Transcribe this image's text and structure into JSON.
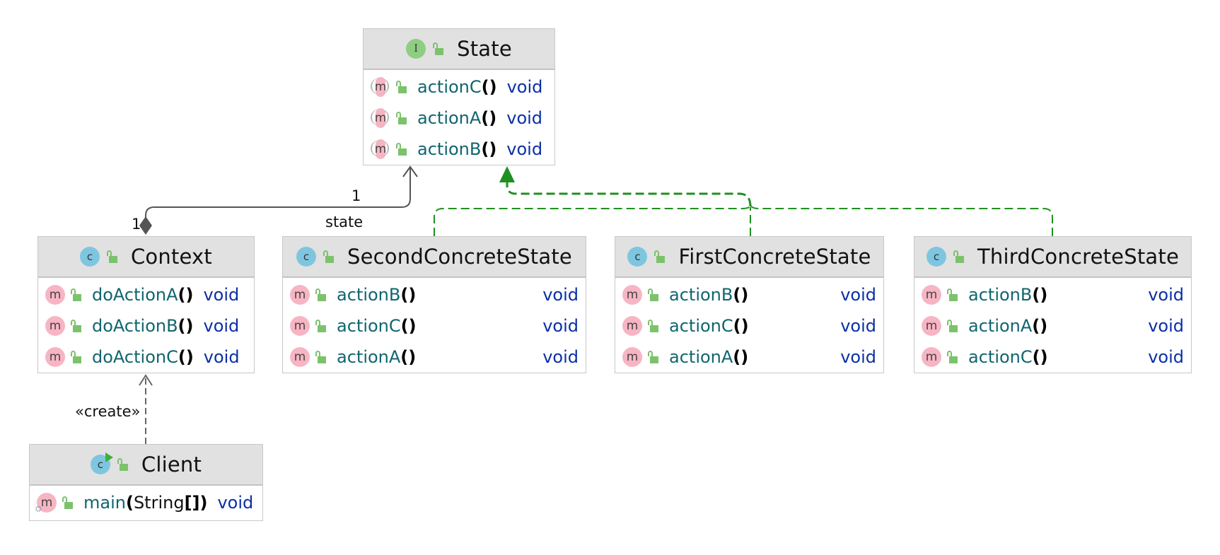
{
  "diagram": {
    "type": "UML class diagram",
    "pattern": "State"
  },
  "colors": {
    "header_bg": "#e1e1e1",
    "border": "#c8c8c8",
    "method_name": "#10656f",
    "return_type": "#0a2fa6",
    "class_icon": "#7ec6e0",
    "interface_icon": "#8fce82",
    "method_icon": "#f7b5c3",
    "lock_icon": "#7cc26c",
    "realization_edge": "#1f8f1f",
    "association_edge": "#555555"
  },
  "nodes": {
    "state": {
      "name": "State",
      "kind": "interface",
      "kind_glyph": "I",
      "methods": [
        {
          "name": "actionC",
          "parens": "()",
          "params": "",
          "parens_close": "",
          "return": "void",
          "abstract": true
        },
        {
          "name": "actionA",
          "parens": "()",
          "params": "",
          "parens_close": "",
          "return": "void",
          "abstract": true
        },
        {
          "name": "actionB",
          "parens": "()",
          "params": "",
          "parens_close": "",
          "return": "void",
          "abstract": true
        }
      ]
    },
    "context": {
      "name": "Context",
      "kind": "class",
      "kind_glyph": "c",
      "methods": [
        {
          "name": "doActionA",
          "parens": "()",
          "return": "void"
        },
        {
          "name": "doActionB",
          "parens": "()",
          "return": "void"
        },
        {
          "name": "doActionC",
          "parens": "()",
          "return": "void"
        }
      ]
    },
    "second": {
      "name": "SecondConcreteState",
      "kind": "class",
      "kind_glyph": "c",
      "methods": [
        {
          "name": "actionB",
          "parens": "()",
          "return": "void"
        },
        {
          "name": "actionC",
          "parens": "()",
          "return": "void"
        },
        {
          "name": "actionA",
          "parens": "()",
          "return": "void"
        }
      ]
    },
    "first": {
      "name": "FirstConcreteState",
      "kind": "class",
      "kind_glyph": "c",
      "methods": [
        {
          "name": "actionB",
          "parens": "()",
          "return": "void"
        },
        {
          "name": "actionC",
          "parens": "()",
          "return": "void"
        },
        {
          "name": "actionA",
          "parens": "()",
          "return": "void"
        }
      ]
    },
    "third": {
      "name": "ThirdConcreteState",
      "kind": "class",
      "kind_glyph": "c",
      "methods": [
        {
          "name": "actionB",
          "parens": "()",
          "return": "void"
        },
        {
          "name": "actionA",
          "parens": "()",
          "return": "void"
        },
        {
          "name": "actionC",
          "parens": "()",
          "return": "void"
        }
      ]
    },
    "client": {
      "name": "Client",
      "kind": "class-executable",
      "kind_glyph": "c",
      "methods": [
        {
          "name": "main",
          "open": "(",
          "params": "String",
          "brackets": "[]",
          "close": ")",
          "return": "void",
          "static": true,
          "static_glyph": "⛭"
        }
      ]
    }
  },
  "edges": {
    "association": {
      "from": "Context",
      "to": "State",
      "kind": "composition",
      "source_multiplicity": "1",
      "target_multiplicity": "1",
      "role": "state"
    },
    "realizations": [
      {
        "from": "SecondConcreteState",
        "to": "State"
      },
      {
        "from": "FirstConcreteState",
        "to": "State"
      },
      {
        "from": "ThirdConcreteState",
        "to": "State"
      }
    ],
    "dependency": {
      "from": "Client",
      "to": "Context",
      "stereotype": "«create»"
    }
  }
}
